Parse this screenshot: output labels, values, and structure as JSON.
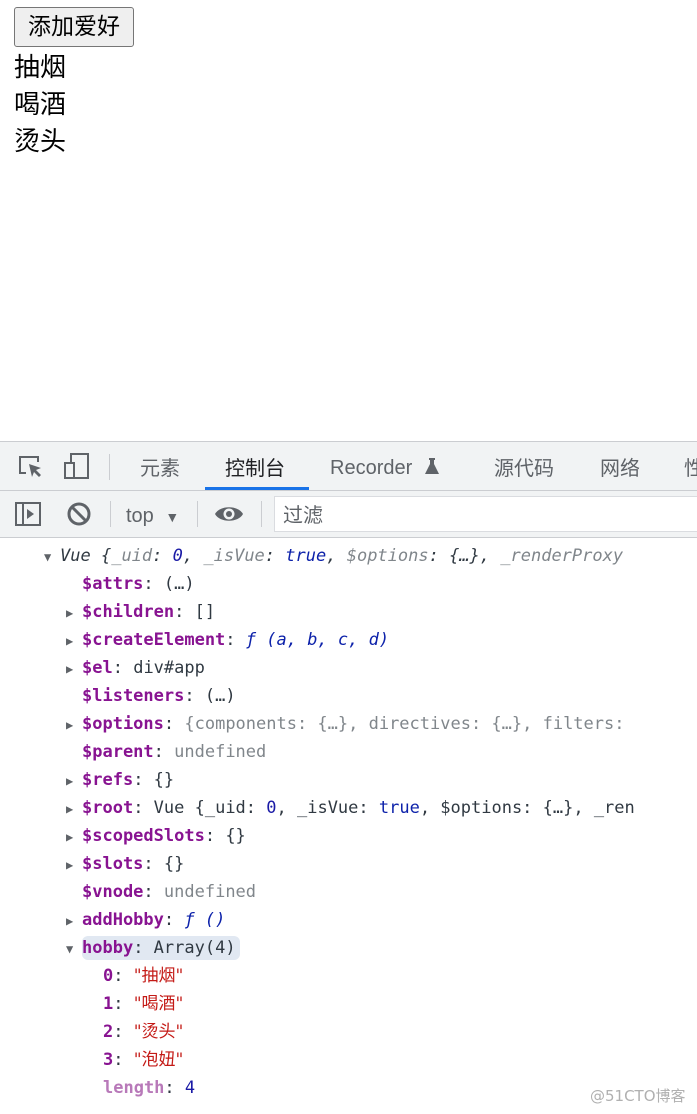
{
  "page": {
    "add_button": "添加爱好",
    "hobbies": [
      "抽烟",
      "喝酒",
      "烫头"
    ]
  },
  "devtools": {
    "tabs": [
      {
        "label": "元素"
      },
      {
        "label": "控制台",
        "active": true
      },
      {
        "label": "Recorder"
      },
      {
        "label": "源代码"
      },
      {
        "label": "网络"
      },
      {
        "label": "性"
      }
    ],
    "context": "top",
    "filter_placeholder": "过滤",
    "accent": "#1a73e8"
  },
  "console": {
    "root": {
      "prefix": "Vue ",
      "text": "{_uid: 0, _isVue: true, $options: {…}, _renderProxy"
    },
    "props": [
      {
        "key": "$attrs",
        "value": "(…)",
        "expandable": false
      },
      {
        "key": "$children",
        "value": "[]",
        "expandable": true
      },
      {
        "key": "$createElement",
        "value": "ƒ (a, b, c, d)",
        "expandable": true
      },
      {
        "key": "$el",
        "value": "div#app",
        "expandable": true
      },
      {
        "key": "$listeners",
        "value": "(…)",
        "expandable": false
      },
      {
        "key": "$options",
        "value": "{components: {…}, directives: {…}, filters:",
        "expandable": true
      },
      {
        "key": "$parent",
        "value": "undefined",
        "expandable": false
      },
      {
        "key": "$refs",
        "value": "{}",
        "expandable": true
      },
      {
        "key": "$root",
        "value": "Vue {_uid: 0, _isVue: true, $options: {…}, _ren",
        "expandable": true
      },
      {
        "key": "$scopedSlots",
        "value": "{}",
        "expandable": true
      },
      {
        "key": "$slots",
        "value": "{}",
        "expandable": true
      },
      {
        "key": "$vnode",
        "value": "undefined",
        "expandable": false
      },
      {
        "key": "addHobby",
        "value": "ƒ ()",
        "expandable": true
      },
      {
        "key": "hobby",
        "value": "Array(4)",
        "expandable": true,
        "expanded": true
      }
    ],
    "hobby_items": [
      {
        "index": "0",
        "value": "\"抽烟\""
      },
      {
        "index": "1",
        "value": "\"喝酒\""
      },
      {
        "index": "2",
        "value": "\"烫头\""
      },
      {
        "index": "3",
        "value": "\"泡妞\""
      }
    ],
    "length_key": "length",
    "length_value": "4"
  },
  "watermark": "@51CTO博客"
}
